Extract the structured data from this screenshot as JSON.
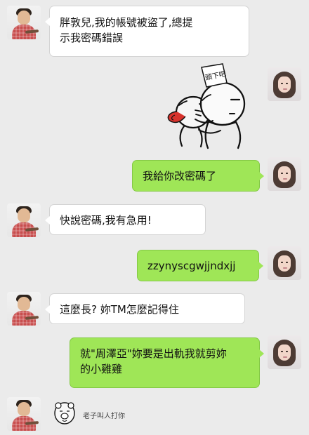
{
  "chat": {
    "messages": [
      {
        "speaker": "left",
        "text": "胖敦兒,我的帳號被盜了,總提\n示我密碼錯誤"
      },
      {
        "speaker": "right",
        "sticker": "頭下吧"
      },
      {
        "speaker": "right",
        "text": "我給你改密碼了"
      },
      {
        "speaker": "left",
        "text": "快說密碼,我有急用!"
      },
      {
        "speaker": "right",
        "text": "zzynyscgwjjndxjj"
      },
      {
        "speaker": "left",
        "text": "這麼長? 妳TM怎麼記得住"
      },
      {
        "speaker": "right",
        "text": "就\"周澤亞\"妳要是出軌我就剪妳\n的小雞雞"
      },
      {
        "speaker": "left",
        "caption": "老子叫人打你"
      }
    ]
  }
}
